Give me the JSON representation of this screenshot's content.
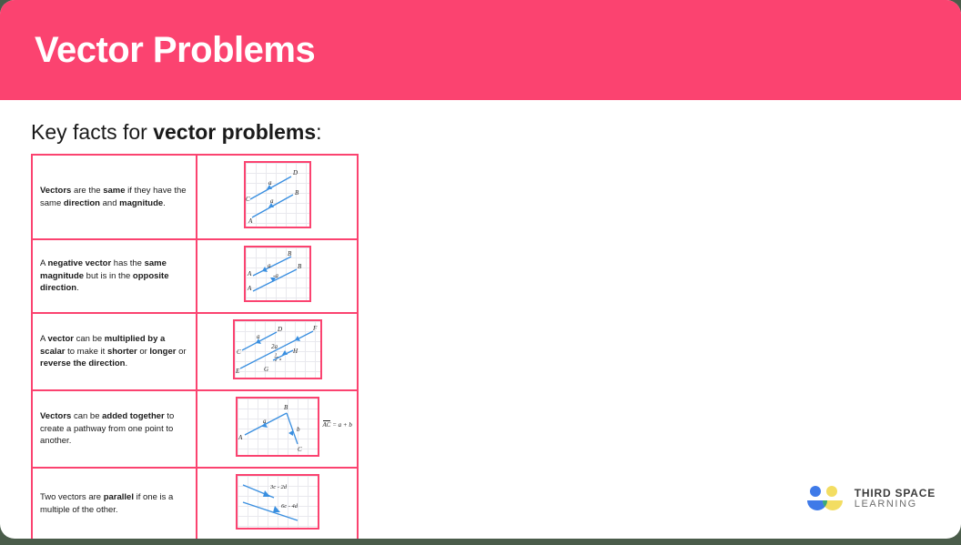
{
  "page": {
    "header_title": "Vector Problems",
    "subtitle_prefix": "Key facts for ",
    "subtitle_bold": "vector problems",
    "subtitle_suffix": ":"
  },
  "colors": {
    "brand_pink": "#fb4370",
    "vector_blue": "#3a8fe0",
    "grid_grey": "#e9e9ee",
    "logo_blue": "#3f7ae8",
    "logo_yellow": "#f3dd62",
    "logo_green": "#3aa97a",
    "page_backdrop": "#4a5c4a"
  },
  "rows": [
    {
      "text_parts": [
        {
          "t": "Vectors",
          "b": true
        },
        {
          "t": " are the ",
          "b": false
        },
        {
          "t": "same",
          "b": true
        },
        {
          "t": " if they have the same ",
          "b": false
        },
        {
          "t": "direction",
          "b": true
        },
        {
          "t": " and ",
          "b": false
        },
        {
          "t": "magnitude",
          "b": true
        },
        {
          "t": ".",
          "b": false
        }
      ],
      "diagram": {
        "name": "equal-vectors-diagram",
        "labels": [
          "a",
          "a",
          "A",
          "B",
          "C",
          "D"
        ]
      }
    },
    {
      "text_parts": [
        {
          "t": "A ",
          "b": false
        },
        {
          "t": "negative vector",
          "b": true
        },
        {
          "t": " has the ",
          "b": false
        },
        {
          "t": "same magnitude",
          "b": true
        },
        {
          "t": " but is in the ",
          "b": false
        },
        {
          "t": "opposite direction",
          "b": true
        },
        {
          "t": ".",
          "b": false
        }
      ],
      "diagram": {
        "name": "negative-vector-diagram",
        "labels": [
          "a",
          "-a",
          "A",
          "B",
          "A",
          "B"
        ]
      }
    },
    {
      "text_parts": [
        {
          "t": "A ",
          "b": false
        },
        {
          "t": "vector",
          "b": true
        },
        {
          "t": " can be ",
          "b": false
        },
        {
          "t": "multiplied by a scalar",
          "b": true
        },
        {
          "t": " to make it ",
          "b": false
        },
        {
          "t": "shorter",
          "b": true
        },
        {
          "t": " or ",
          "b": false
        },
        {
          "t": "longer",
          "b": true
        },
        {
          "t": " or ",
          "b": false
        },
        {
          "t": "reverse the direction",
          "b": true
        },
        {
          "t": ".",
          "b": false
        }
      ],
      "diagram": {
        "name": "scalar-multiple-diagram",
        "labels": [
          "a",
          "2a",
          "1/2 a",
          "C",
          "D",
          "E",
          "F",
          "G",
          "H"
        ]
      }
    },
    {
      "text_parts": [
        {
          "t": "Vectors",
          "b": true
        },
        {
          "t": " can be ",
          "b": false
        },
        {
          "t": "added together",
          "b": true
        },
        {
          "t": " to create a pathway from one point to another.",
          "b": false
        }
      ],
      "diagram": {
        "name": "vector-addition-diagram",
        "labels": [
          "a",
          "b",
          "A",
          "B",
          "C"
        ],
        "equation_left": "AC",
        "equation_right": " = a + b"
      }
    },
    {
      "text_parts": [
        {
          "t": "Two vectors are ",
          "b": false
        },
        {
          "t": "parallel",
          "b": true
        },
        {
          "t": " if one is a multiple of the other.",
          "b": false
        }
      ],
      "diagram": {
        "name": "parallel-vectors-diagram",
        "labels": [
          "3c - 2d",
          "6c - 4d"
        ]
      }
    }
  ],
  "logo": {
    "line1": "THIRD SPACE",
    "line2": "LEARNING"
  }
}
